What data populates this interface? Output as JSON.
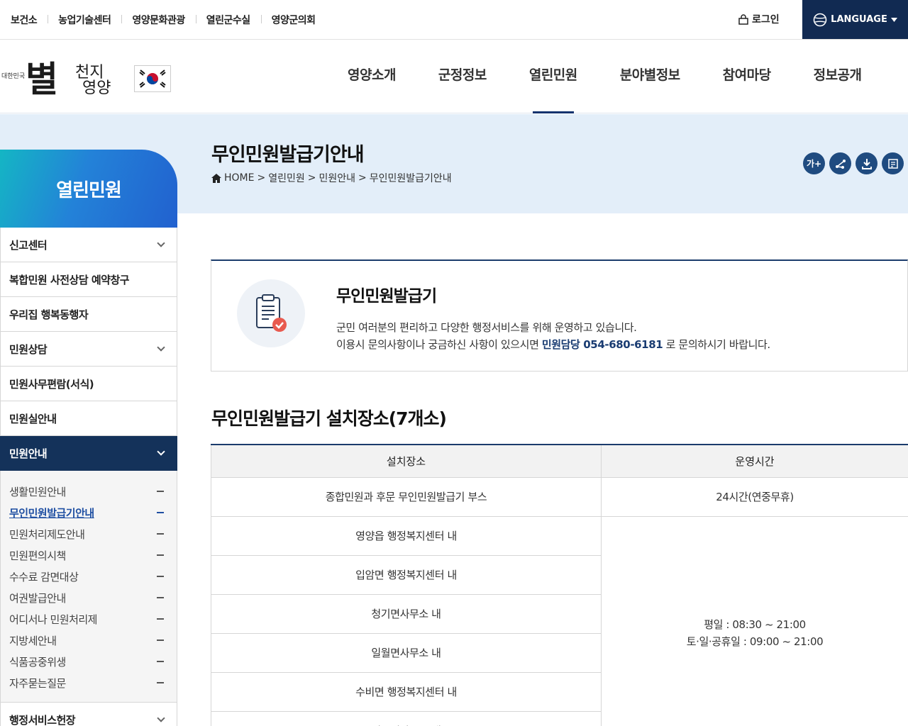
{
  "top_links": [
    "보건소",
    "농업기술센터",
    "영양문화관광",
    "열린군수실",
    "영양군의회"
  ],
  "login_label": "로그인",
  "language_label": "LANGUAGE",
  "logo": {
    "small": "대한민국",
    "big": "별",
    "sub1": "천지",
    "sub2": "영양"
  },
  "gnb": [
    "영양소개",
    "군정정보",
    "열린민원",
    "분야별정보",
    "참여마당",
    "정보공개"
  ],
  "lnb_title": "열린민원",
  "lnb_items": [
    {
      "label": "신고센터"
    },
    {
      "label": "복합민원 사전상담 예약창구"
    },
    {
      "label": "우리집 행복동행자"
    },
    {
      "label": "민원상담"
    },
    {
      "label": "민원사무편람(서식)"
    },
    {
      "label": "민원실안내"
    },
    {
      "label": "민원안내"
    }
  ],
  "lnb_sub": [
    "생활민원안내",
    "무인민원발급기안내",
    "민원처리제도안내",
    "민원편의시책",
    "수수료 감면대상",
    "여권발급안내",
    "어디서나 민원처리제",
    "지방세안내",
    "식품공중위생",
    "자주묻는질문"
  ],
  "lnb_last": "행정서비스헌장",
  "page": {
    "title": "무인민원발급기안내",
    "breadcrumb": [
      "HOME",
      "열린민원",
      "민원안내",
      "무인민원발급기안내"
    ],
    "tools": [
      "가+",
      "share",
      "download",
      "print"
    ]
  },
  "info": {
    "title": "무인민원발급기",
    "line1": "군민 여러분의 편리하고 다양한 행정서비스를 위해 운영하고 있습니다.",
    "line2_pre": "이용시 문의사항이나 궁금하신 사항이 있으시면 ",
    "line2_hl": "민원담당 054-680-6181",
    "line2_post": " 로 문의하시기 바랍니다."
  },
  "section_title": "무인민원발급기 설치장소(7개소)",
  "table": {
    "headers": [
      "설치장소",
      "운영시간"
    ],
    "row1": {
      "place": "종합민원과 후문 무인민원발급기 부스",
      "time": "24시간(연중무휴)"
    },
    "places": [
      "영양읍 행정복지센터 내",
      "입암면 행정복지센터 내",
      "청기면사무소 내",
      "일월면사무소 내",
      "수비면 행정복지센터 내",
      "석보면사무소 내"
    ],
    "time_weekday": "평일 : 08:30 ~ 21:00",
    "time_weekend": "토·일·공휴일 : 09:00 ~ 21:00"
  }
}
